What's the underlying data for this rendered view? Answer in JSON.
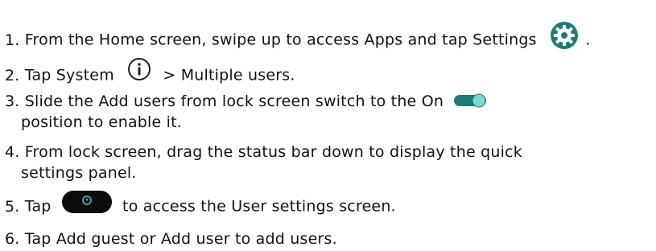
{
  "steps": [
    {
      "num": "1.",
      "text_before_icon": "From the Home screen, swipe up to access Apps and tap Settings",
      "icon": "gear-icon",
      "text_after_icon": "."
    },
    {
      "num": "2.",
      "text_before_icon": "Tap System",
      "icon": "info-icon",
      "text_after_icon": "> Multiple users."
    },
    {
      "num": "3.",
      "line1_before_icon": "Slide the Add users from lock screen switch to the On",
      "icon": "toggle-on-icon",
      "line2": "position to enable it."
    },
    {
      "num": "4.",
      "line1": "From lock screen, drag the status bar down to display the quick",
      "line2": "settings panel."
    },
    {
      "num": "5.",
      "text_before_icon": "Tap",
      "icon": "user-switch-icon",
      "text_after_icon": "to access the User settings screen."
    },
    {
      "num": "6.",
      "text": "Tap Add guest or Add user to add users."
    }
  ],
  "colors": {
    "icon_teal": "#1f7a72",
    "toggle_track": "#1f7a72",
    "toggle_knob": "#7fd9cf",
    "user_pill": "#0b0b0b",
    "user_glyph": "#35a3b5"
  }
}
